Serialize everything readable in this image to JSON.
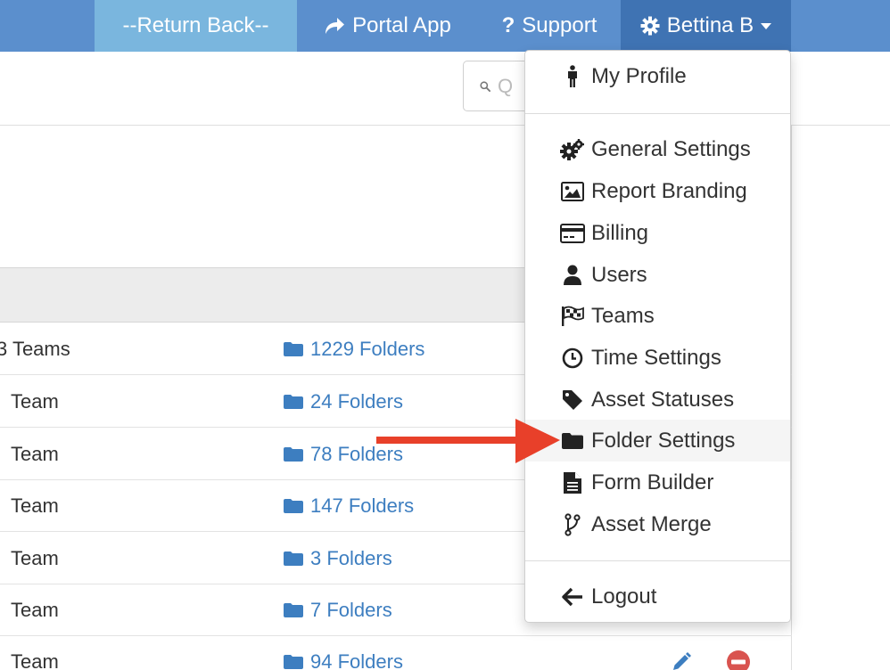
{
  "nav": {
    "return_label": "--Return Back--",
    "portal_label": "Portal App",
    "support_label": "Support",
    "user_label": "Bettina B"
  },
  "search": {
    "placeholder": "Q"
  },
  "table": {
    "rows": [
      {
        "teams": "3 Teams",
        "folders": "1229 Folders"
      },
      {
        "teams": "Team",
        "folders": "24 Folders"
      },
      {
        "teams": "Team",
        "folders": "78 Folders"
      },
      {
        "teams": "Team",
        "folders": "147 Folders"
      },
      {
        "teams": "Team",
        "folders": "3 Folders"
      },
      {
        "teams": "Team",
        "folders": "7 Folders"
      },
      {
        "teams": "Team",
        "folders": "94 Folders"
      }
    ]
  },
  "menu": {
    "my_profile": "My Profile",
    "general_settings": "General Settings",
    "report_branding": "Report Branding",
    "billing": "Billing",
    "users": "Users",
    "teams": "Teams",
    "time_settings": "Time Settings",
    "asset_statuses": "Asset Statuses",
    "folder_settings": "Folder Settings",
    "form_builder": "Form Builder",
    "asset_merge": "Asset Merge",
    "logout": "Logout"
  },
  "colors": {
    "nav_bg": "#5b8fcd",
    "return_bg": "#7ab6de",
    "user_bg": "#3f73b3",
    "link": "#3d7ec0",
    "arrow": "#e8402a",
    "delete": "#d9534f"
  }
}
